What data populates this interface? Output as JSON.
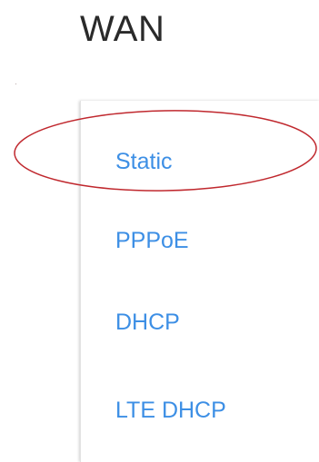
{
  "header": {
    "title": "WAN"
  },
  "menu": {
    "items": [
      {
        "label": "Static"
      },
      {
        "label": "PPPoE"
      },
      {
        "label": "DHCP"
      },
      {
        "label": "LTE DHCP"
      }
    ],
    "selected": "Static"
  },
  "colors": {
    "link": "#3d8fe5",
    "title": "#2a2a2a",
    "annotation": "#c0282e"
  }
}
